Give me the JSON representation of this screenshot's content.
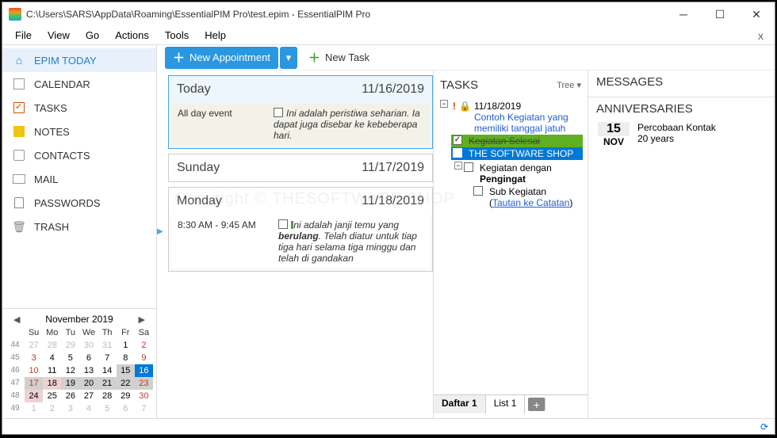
{
  "titlebar": {
    "title": "C:\\Users\\SARS\\AppData\\Roaming\\EssentialPIM Pro\\test.epim - EssentialPIM Pro"
  },
  "menu": {
    "file": "File",
    "view": "View",
    "go": "Go",
    "actions": "Actions",
    "tools": "Tools",
    "help": "Help"
  },
  "nav": {
    "today": "EPIM TODAY",
    "calendar": "CALENDAR",
    "tasks": "TASKS",
    "notes": "NOTES",
    "contacts": "CONTACTS",
    "mail": "MAIL",
    "passwords": "PASSWORDS",
    "trash": "TRASH"
  },
  "minical": {
    "title": "November  2019",
    "dow": [
      "Su",
      "Mo",
      "Tu",
      "We",
      "Th",
      "Fr",
      "Sa"
    ],
    "rows": [
      {
        "wk": "44",
        "d": [
          "27",
          "28",
          "29",
          "30",
          "31",
          "1",
          "2"
        ],
        "muted": [
          0,
          1,
          2,
          3,
          4
        ]
      },
      {
        "wk": "45",
        "d": [
          "3",
          "4",
          "5",
          "6",
          "7",
          "8",
          "9"
        ]
      },
      {
        "wk": "46",
        "d": [
          "10",
          "11",
          "12",
          "13",
          "14",
          "15",
          "16"
        ],
        "sel": 5,
        "today": 6
      },
      {
        "wk": "47",
        "d": [
          "17",
          "18",
          "19",
          "20",
          "21",
          "22",
          "23"
        ],
        "hl": 1,
        "selwk": true
      },
      {
        "wk": "48",
        "d": [
          "24",
          "25",
          "26",
          "27",
          "28",
          "29",
          "30"
        ],
        "hl": 0
      },
      {
        "wk": "49",
        "d": [
          "1",
          "2",
          "3",
          "4",
          "5",
          "6",
          "7"
        ],
        "muted": [
          0,
          1,
          2,
          3,
          4,
          5,
          6
        ]
      }
    ]
  },
  "toolbar": {
    "new_appt": "New Appointment",
    "new_task": "New Task"
  },
  "days": {
    "today_label": "Today",
    "today_date": "11/16/2019",
    "today_lft": "All day event",
    "today_rgt": "Ini adalah peristiwa seharian. Ia dapat juga disebar ke kebeberapa hari.",
    "sunday_label": "Sunday",
    "sunday_date": "11/17/2019",
    "monday_label": "Monday",
    "monday_date": "11/18/2019",
    "monday_time": "8:30 AM - 9:45 AM",
    "monday_rgt_pre": "Ini adalah janji temu yang ",
    "monday_rgt_b": "berulang",
    "monday_rgt_post": ". Telah diatur untuk tiap tiga hari selama tiga minggu dan telah di gandakan"
  },
  "tasks": {
    "heading": "TASKS",
    "tree_label": "Tree ▾",
    "date": "11/18/2019",
    "t1": "Contoh Kegiatan yang memiliki tanggal jatuh",
    "t2": "Kegiatan Selesai",
    "t3": "THE SOFTWARE SHOP",
    "t4a": "Kegiatan dengan ",
    "t4b": "Pengingat",
    "t5a": "Sub Kegiatan (",
    "t5link": "Tautan ke Catatan",
    "t5b": ")",
    "tab1": "Daftar 1",
    "tab2": "List 1"
  },
  "right": {
    "messages": "MESSAGES",
    "anniv_h": "ANNIVERSARIES",
    "anniv_day": "15",
    "anniv_mon": "NOV",
    "anniv_name": "Percobaan Kontak",
    "anniv_yrs": "20 years"
  },
  "watermark": "Copyright © THESOFTWARE.SHOP"
}
